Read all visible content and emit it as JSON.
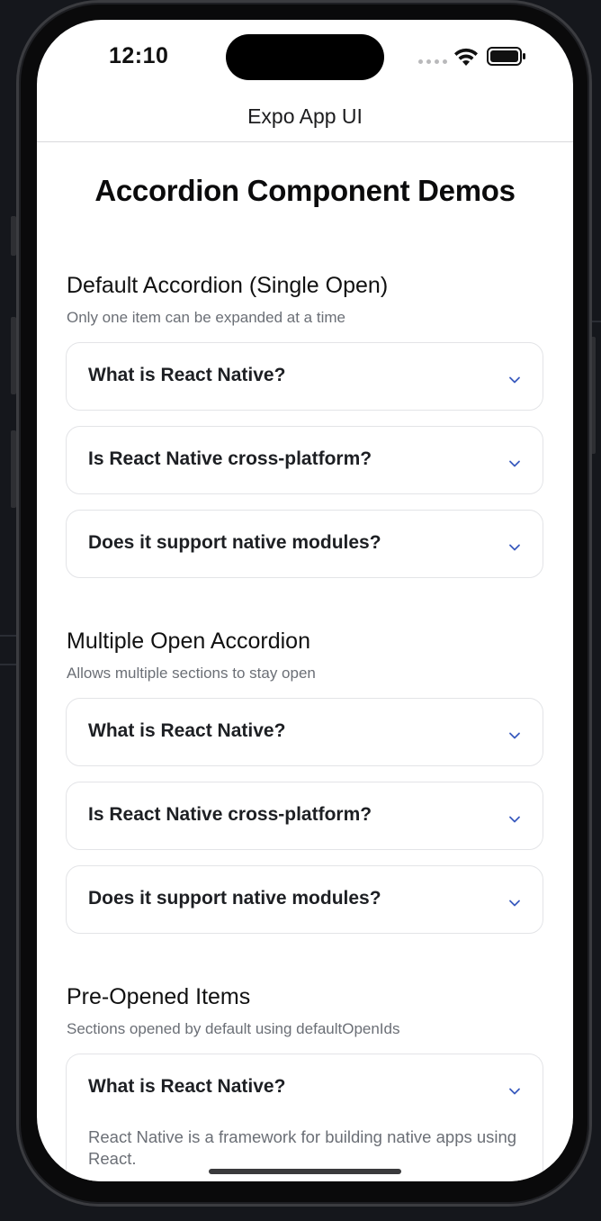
{
  "status_bar": {
    "time": "12:10"
  },
  "nav": {
    "title": "Expo App UI"
  },
  "page": {
    "title": "Accordion Component Demos"
  },
  "sections": [
    {
      "title": "Default Accordion (Single Open)",
      "subtitle": "Only one item can be expanded at a time",
      "items": [
        {
          "question": "What is React Native?"
        },
        {
          "question": "Is React Native cross-platform?"
        },
        {
          "question": "Does it support native modules?"
        }
      ]
    },
    {
      "title": "Multiple Open Accordion",
      "subtitle": "Allows multiple sections to stay open",
      "items": [
        {
          "question": "What is React Native?"
        },
        {
          "question": "Is React Native cross-platform?"
        },
        {
          "question": "Does it support native modules?"
        }
      ]
    },
    {
      "title": "Pre-Opened Items",
      "subtitle": "Sections opened by default using defaultOpenIds",
      "items": [
        {
          "question": "What is React Native?",
          "answer": "React Native is a framework for building native apps using React.",
          "open": true
        }
      ]
    }
  ],
  "icons": {
    "chevron": "chevron-down-icon",
    "wifi": "wifi-icon",
    "battery": "battery-icon",
    "signal": "signal-icon"
  },
  "colors": {
    "chevron": "#3a5bbf",
    "border": "#e3e4e7",
    "subtitle": "#6b6f76"
  }
}
